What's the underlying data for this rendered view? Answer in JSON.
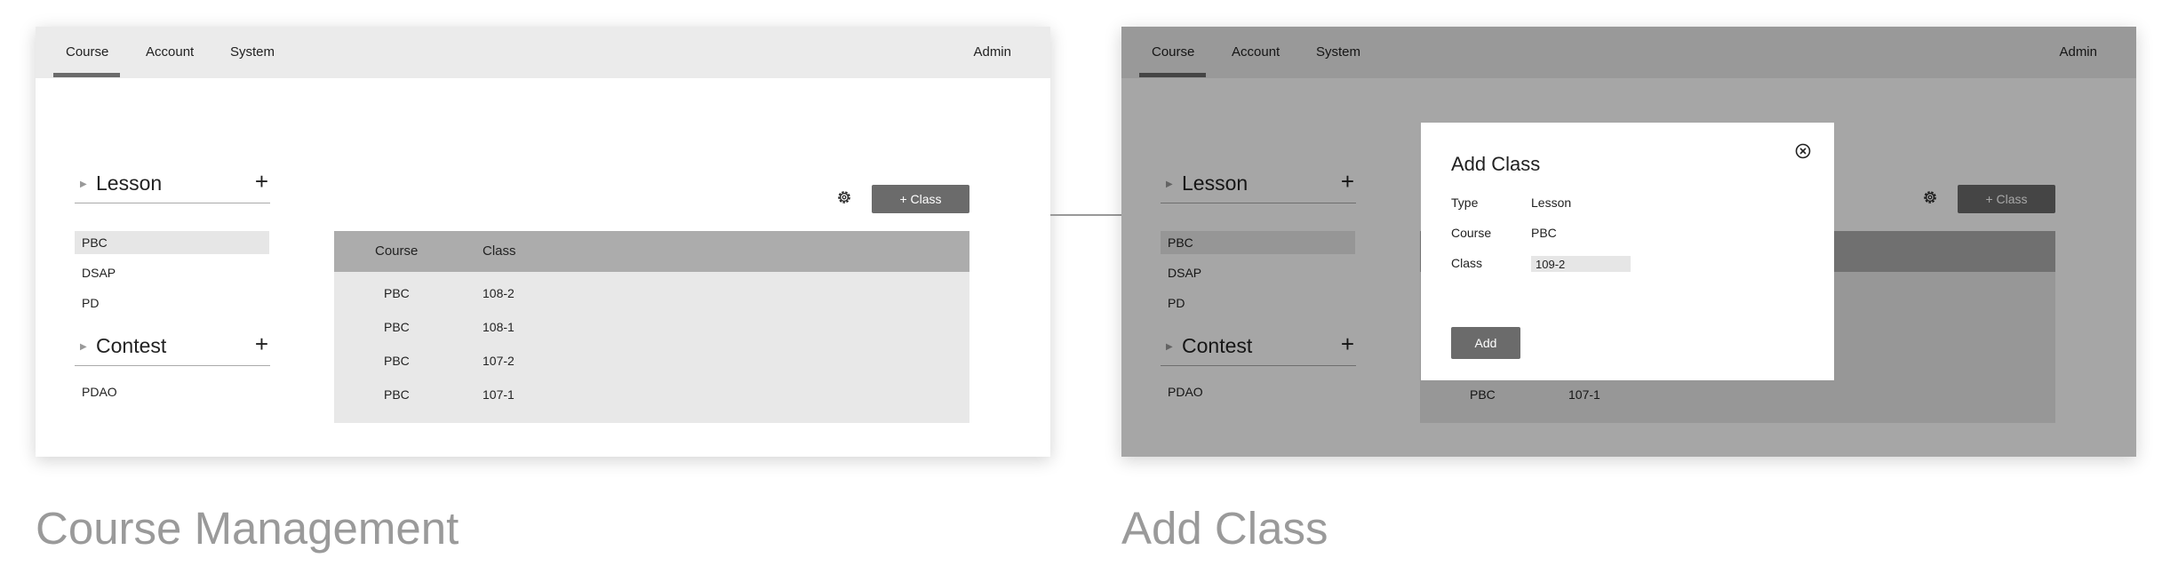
{
  "screens": [
    {
      "caption": "Course Management",
      "nav": {
        "tabs": [
          "Course",
          "Account",
          "System"
        ],
        "active": "Course",
        "user": "Admin"
      },
      "sidebar": {
        "sections": [
          {
            "title": "Lesson",
            "items": [
              "PBC",
              "DSAP",
              "PD"
            ],
            "selected": "PBC"
          },
          {
            "title": "Contest",
            "items": [
              "PDAO"
            ]
          }
        ]
      },
      "toolbar": {
        "add_class_label": "+ Class"
      },
      "table": {
        "columns": [
          "Course",
          "Class"
        ],
        "rows": [
          [
            "PBC",
            "108-2"
          ],
          [
            "PBC",
            "108-1"
          ],
          [
            "PBC",
            "107-2"
          ],
          [
            "PBC",
            "107-1"
          ]
        ]
      }
    },
    {
      "caption": "Add Class",
      "nav": {
        "tabs": [
          "Course",
          "Account",
          "System"
        ],
        "active": "Course",
        "user": "Admin"
      },
      "sidebar": {
        "sections": [
          {
            "title": "Lesson",
            "items": [
              "PBC",
              "DSAP",
              "PD"
            ],
            "selected": "PBC"
          },
          {
            "title": "Contest",
            "items": [
              "PDAO"
            ]
          }
        ]
      },
      "toolbar": {
        "add_class_label": "+ Class"
      },
      "table": {
        "visible_row": [
          "PBC",
          "107-1"
        ]
      },
      "modal": {
        "title": "Add Class",
        "fields": [
          {
            "label": "Type",
            "value": "Lesson"
          },
          {
            "label": "Course",
            "value": "PBC"
          },
          {
            "label": "Class",
            "value": "109-2"
          }
        ],
        "submit_label": "Add"
      }
    }
  ],
  "colors": {
    "topbar": "#ebebeb",
    "accent": "#6b6b6b",
    "table_header": "#acacac",
    "table_body": "#e8e8e8",
    "caption": "#9a9a9a"
  },
  "icons": {
    "settings": "gear-icon",
    "close": "close-circle-icon",
    "add": "plus-icon",
    "expand": "triangle-right-icon"
  }
}
